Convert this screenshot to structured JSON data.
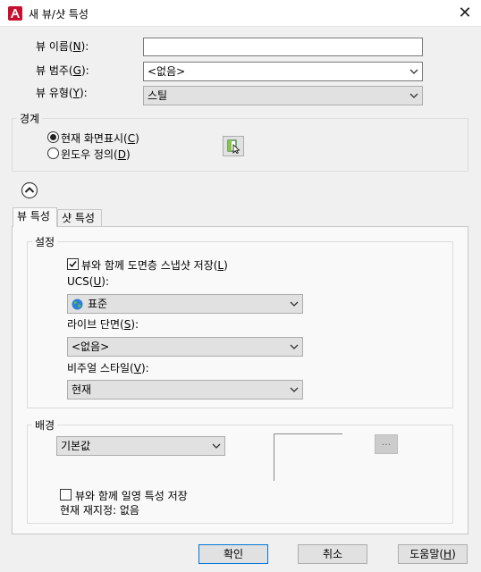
{
  "dialog": {
    "title": "새 뷰/샷 특성",
    "close_glyph": "✕"
  },
  "fields": {
    "view_name": {
      "label": "뷰 이름(",
      "key": "N",
      "suffix": "):",
      "value": ""
    },
    "view_category": {
      "label": "뷰 범주(",
      "key": "G",
      "suffix": "):",
      "value": "<없음>"
    },
    "view_type": {
      "label": "뷰 유형(",
      "key": "Y",
      "suffix": "):",
      "value": "스틸"
    }
  },
  "boundary": {
    "title": "경계",
    "current_display": {
      "label": "현재 화면표시(",
      "key": "C",
      "suffix": ")"
    },
    "define_window": {
      "label": "윈도우 정의(",
      "key": "D",
      "suffix": ")"
    }
  },
  "tabs": [
    {
      "label": "뷰 특성"
    },
    {
      "label": "샷 특성"
    }
  ],
  "settings": {
    "title": "설정",
    "save_layer_snapshot": {
      "label": "뷰와 함께 도면층 스냅샷 저장(",
      "key": "L",
      "suffix": ")",
      "checked": true
    },
    "ucs": {
      "label": "UCS(",
      "key": "U",
      "suffix": "):",
      "value": "표준"
    },
    "live_section": {
      "label": "라이브 단면(",
      "key": "S",
      "suffix": "):",
      "value": "<없음>"
    },
    "visual_style": {
      "label": "비주얼 스타일(",
      "key": "V",
      "suffix": "):",
      "value": "현재"
    }
  },
  "background": {
    "title": "배경",
    "type_value": "기본값",
    "browse_label": "...",
    "save_sun": {
      "label": "뷰와 함께 일영 특성 저장",
      "checked": false
    },
    "current_override": "현재 재지정: 없음"
  },
  "buttons": {
    "ok": "확인",
    "cancel": "취소",
    "help": {
      "label": "도움말(",
      "key": "H",
      "suffix": ")"
    }
  },
  "colors": {
    "accent": "#0078d7",
    "app_icon": "#c8102e"
  }
}
